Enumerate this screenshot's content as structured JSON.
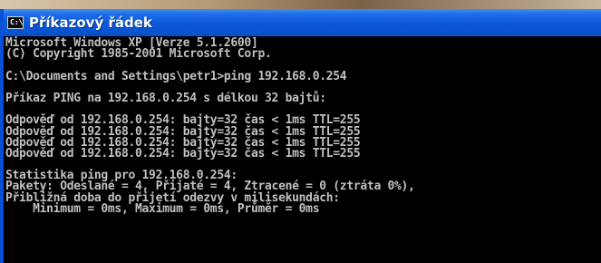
{
  "window": {
    "title": "Příkazový řádek",
    "icon_name": "command-prompt-icon",
    "icon_glyph": "C:\\"
  },
  "console": {
    "lines": [
      "Microsoft Windows XP [Verze 5.1.2600]",
      "(C) Copyright 1985-2001 Microsoft Corp.",
      "",
      "C:\\Documents and Settings\\petr1>ping 192.168.0.254",
      "",
      "Příkaz PING na 192.168.0.254 s délkou 32 bajtů:",
      "",
      "Odpověď od 192.168.0.254: bajty=32 čas < 1ms TTL=255",
      "Odpověď od 192.168.0.254: bajty=32 čas < 1ms TTL=255",
      "Odpověď od 192.168.0.254: bajty=32 čas < 1ms TTL=255",
      "Odpověď od 192.168.0.254: bajty=32 čas < 1ms TTL=255",
      "",
      "Statistika ping pro 192.168.0.254:",
      "Pakety: Odeslané = 4, Přijaté = 4, Ztracené = 0 (ztráta 0%),",
      "Přibližná doba do přijetí odezvy v milisekundách:",
      "    Minimum = 0ms, Maximum = 0ms, Průměr = 0ms"
    ]
  },
  "colors": {
    "titlebar_blue": "#0a58d9",
    "console_background": "#000000",
    "console_text": "#c0c0c0"
  }
}
